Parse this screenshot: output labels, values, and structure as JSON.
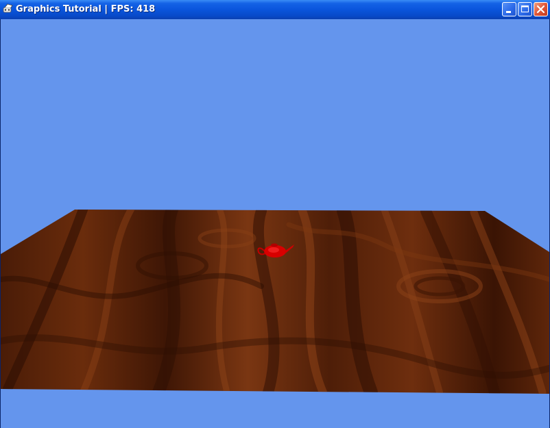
{
  "window": {
    "title": "Graphics Tutorial | FPS: 418",
    "icon": "app-icon",
    "buttons": {
      "minimize_icon": "minimize-icon",
      "maximize_icon": "maximize-icon",
      "close_icon": "close-icon"
    }
  },
  "scene": {
    "clear_color": "#6495ED",
    "floor_texture": "wood-grain",
    "floor_colors": [
      "#3B1606",
      "#5A2509",
      "#7A3510",
      "#4A1D07"
    ],
    "object": "teapot",
    "object_color": "#E00000"
  }
}
